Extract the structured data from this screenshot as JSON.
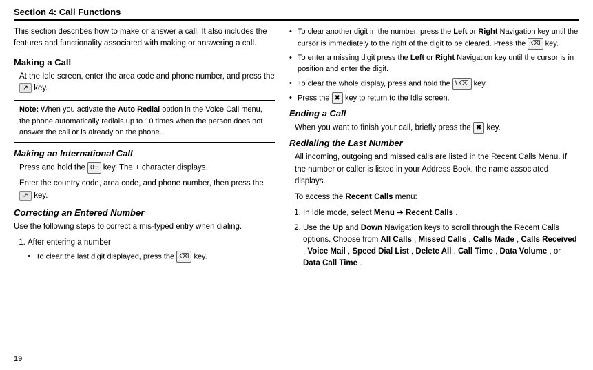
{
  "page": {
    "section_title": "Section 4: Call Functions",
    "page_number": "19"
  },
  "left": {
    "intro": "This section describes how to make or answer a call. It also includes the features and functionality associated with making or answering a call.",
    "making_call_title": "Making a Call",
    "making_call_text": "At the Idle screen, enter the area code and phone number, and press the",
    "making_call_key": "↗",
    "making_call_suffix": "key.",
    "note_label": "Note:",
    "note_text": "When you activate the",
    "note_bold": "Auto Redial",
    "note_text2": "option in the Voice Call menu, the phone automatically redials up to 10 times when the person does not answer the call or is already on the phone.",
    "intl_call_title": "Making an International Call",
    "intl_call_text1": "Press and hold the",
    "intl_call_key": "0+",
    "intl_call_text2": "key. The + character displays.",
    "intl_call_text3": "Enter the country code, area code, and phone number, then press the",
    "intl_call_key2": "↗",
    "intl_call_text4": "key.",
    "correcting_title": "Correcting an Entered Number",
    "correcting_text": "Use the following steps to correct a mis-typed entry when dialing.",
    "step1_label": "1.",
    "step1_text": "After entering a number",
    "bullet1": "To clear the last digit displayed, press the",
    "bullet1_key": "⌫",
    "bullet1_suffix": "key."
  },
  "right": {
    "bullet2": "To clear another digit in the number, press the",
    "bullet2_bold1": "Left",
    "bullet2_text2": "or",
    "bullet2_bold2": "Right",
    "bullet2_text3": "Navigation key until the cursor is immediately to the right of the digit to be cleared. Press the",
    "bullet2_key": "⌫",
    "bullet2_suffix": "key.",
    "bullet3": "To enter a missing digit press the",
    "bullet3_bold1": "Left",
    "bullet3_text2": "or",
    "bullet3_bold2": "Right",
    "bullet3_text3": "Navigation key until the cursor is in position and enter the digit.",
    "bullet4": "To clear the whole display, press and hold the",
    "bullet4_key": "⌫",
    "bullet4_suffix": "key.",
    "bullet5": "Press the",
    "bullet5_key": "✖",
    "bullet5_suffix": "key to return to the Idle screen.",
    "ending_title": "Ending a Call",
    "ending_text": "When you want to finish your call, briefly press the",
    "ending_key": "✖",
    "ending_suffix": "key.",
    "redialing_title": "Redialing the Last Number",
    "redialing_text": "All incoming, outgoing and missed calls are listed in the Recent Calls Menu. If the number or caller is listed in your Address Book, the name associated displays.",
    "access_text": "To access the",
    "access_bold": "Recent Calls",
    "access_suffix": "menu:",
    "step1_label": "1.",
    "step1_text1": "In Idle mode, select",
    "step1_bold1": "Menu",
    "step1_arrow": "→",
    "step1_bold2": "Recent Calls",
    "step1_suffix": ".",
    "step2_label": "2.",
    "step2_text1": "Use the",
    "step2_bold1": "Up",
    "step2_text2": "and",
    "step2_bold2": "Down",
    "step2_text3": "Navigation keys to scroll through the Recent Calls options. Choose from",
    "step2_bold3": "All Calls",
    "step2_text4": ",",
    "step2_bold4": "Missed Calls",
    "step2_text5": ",",
    "step2_bold5": "Calls Made",
    "step2_text6": ",",
    "step2_bold6": "Calls Received",
    "step2_text7": ",",
    "step2_bold7": "Voice Mail",
    "step2_text8": ",",
    "step2_bold8": "Speed Dial List",
    "step2_text9": ",",
    "step2_bold9": "Delete All",
    "step2_text10": ",",
    "step2_bold10": "Call Time",
    "step2_text11": ",",
    "step2_bold11": "Data Volume",
    "step2_text12": ", or",
    "step2_bold12": "Data Call Time",
    "step2_suffix": "."
  }
}
